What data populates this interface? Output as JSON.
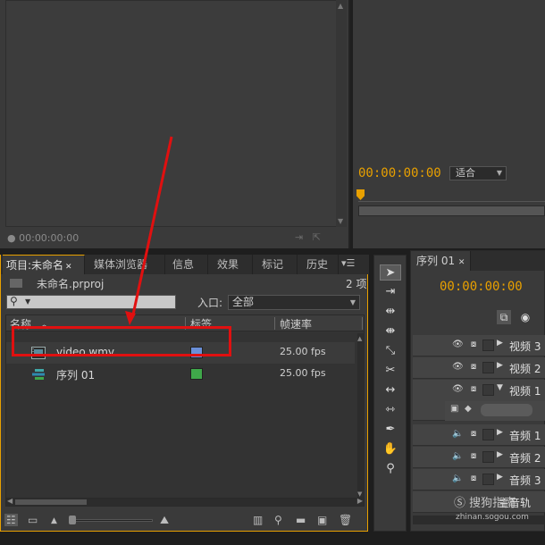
{
  "source_monitor": {
    "timecode": "00:00:00:00"
  },
  "program_monitor": {
    "timecode": "00:00:00:00",
    "fit": "适合"
  },
  "project_panel": {
    "tabs": [
      {
        "label": "项目:未命名",
        "active": true
      },
      {
        "label": "媒体浏览器"
      },
      {
        "label": "信息"
      },
      {
        "label": "效果"
      },
      {
        "label": "标记"
      },
      {
        "label": "历史"
      }
    ],
    "file_name": "未命名.prproj",
    "item_count": "2 项",
    "search_placeholder": "",
    "in_label": "入口:",
    "in_value": "全部",
    "columns": {
      "name": "名称",
      "label": "标签",
      "framerate": "帧速率"
    },
    "items": [
      {
        "name": "video.wmv",
        "label_color": "#6a8fd8",
        "fps": "25.00 fps",
        "icon": "video-clip-icon"
      },
      {
        "name": "序列 01",
        "label_color": "#3fa84a",
        "fps": "25.00 fps",
        "icon": "sequence-icon"
      }
    ]
  },
  "sequence_panel": {
    "tab": "序列 01",
    "timecode": "00:00:00:00",
    "tracks": [
      {
        "name": "视频 3",
        "type": "video"
      },
      {
        "name": "视频 2",
        "type": "video"
      },
      {
        "name": "视频 1",
        "type": "video",
        "expanded": true
      },
      {
        "name": "音频 1",
        "type": "audio"
      },
      {
        "name": "音频 2",
        "type": "audio"
      },
      {
        "name": "音频 3",
        "type": "audio"
      },
      {
        "name": "主音轨",
        "type": "master"
      }
    ]
  },
  "watermark": {
    "text": "搜狗指南",
    "url": "zhinan.sogou.com"
  },
  "colors": {
    "accent": "#e8a000",
    "highlight": "#e01010",
    "panel": "#3a3a3a"
  }
}
